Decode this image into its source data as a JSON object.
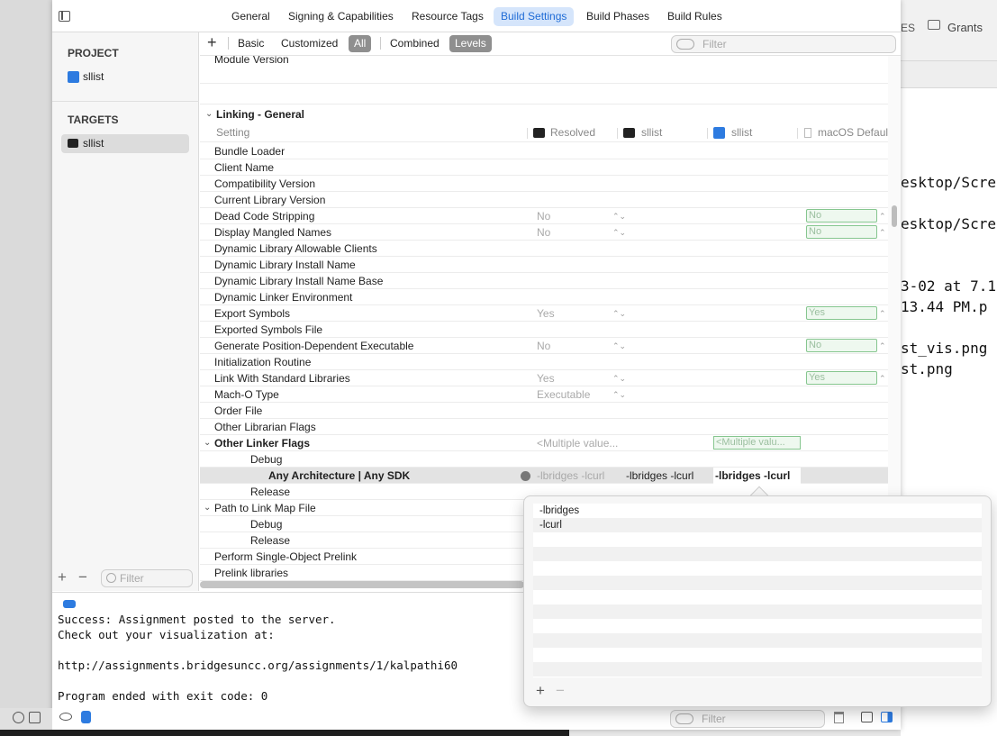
{
  "window_tabs": [
    "General",
    "Signing & Capabilities",
    "Resource Tags",
    "Build Settings",
    "Build Phases",
    "Build Rules"
  ],
  "active_tab": "Build Settings",
  "sidebar": {
    "project_header": "PROJECT",
    "project_item": "sllist",
    "targets_header": "TARGETS",
    "target_item": "sllist",
    "filter_placeholder": "Filter"
  },
  "scope_bar": {
    "add": "+",
    "basic": "Basic",
    "customized": "Customized",
    "all": "All",
    "combined": "Combined",
    "levels": "Levels",
    "filter_placeholder": "Filter"
  },
  "prev_row": "Module Version",
  "section": {
    "title": "Linking - General",
    "col_setting": "Setting",
    "col_resolved": "Resolved",
    "col_target": "sllist",
    "col_project": "sllist",
    "col_default": "macOS Default"
  },
  "rows": [
    {
      "name": "Bundle Loader",
      "resolved": "",
      "target": "",
      "project": "",
      "default": ""
    },
    {
      "name": "Client Name",
      "resolved": "",
      "target": "",
      "project": "",
      "default": ""
    },
    {
      "name": "Compatibility Version",
      "resolved": "",
      "target": "",
      "project": "",
      "default": ""
    },
    {
      "name": "Current Library Version",
      "resolved": "",
      "target": "",
      "project": "",
      "default": ""
    },
    {
      "name": "Dead Code Stripping",
      "resolved": "No",
      "target": "",
      "project": "",
      "default": "No"
    },
    {
      "name": "Display Mangled Names",
      "resolved": "No",
      "target": "",
      "project": "",
      "default": "No"
    },
    {
      "name": "Dynamic Library Allowable Clients",
      "resolved": "",
      "target": "",
      "project": "",
      "default": ""
    },
    {
      "name": "Dynamic Library Install Name",
      "resolved": "",
      "target": "",
      "project": "",
      "default": ""
    },
    {
      "name": "Dynamic Library Install Name Base",
      "resolved": "",
      "target": "",
      "project": "",
      "default": ""
    },
    {
      "name": "Dynamic Linker Environment",
      "resolved": "",
      "target": "",
      "project": "",
      "default": ""
    },
    {
      "name": "Export Symbols",
      "resolved": "Yes",
      "target": "",
      "project": "",
      "default": "Yes"
    },
    {
      "name": "Exported Symbols File",
      "resolved": "",
      "target": "",
      "project": "",
      "default": ""
    },
    {
      "name": "Generate Position-Dependent Executable",
      "resolved": "No",
      "target": "",
      "project": "",
      "default": "No"
    },
    {
      "name": "Initialization Routine",
      "resolved": "",
      "target": "",
      "project": "",
      "default": ""
    },
    {
      "name": "Link With Standard Libraries",
      "resolved": "Yes",
      "target": "",
      "project": "",
      "default": "Yes"
    },
    {
      "name": "Mach-O Type",
      "resolved": "Executable",
      "target": "",
      "project": "",
      "default": ""
    },
    {
      "name": "Order File",
      "resolved": "",
      "target": "",
      "project": "",
      "default": ""
    },
    {
      "name": "Other Librarian Flags",
      "resolved": "",
      "target": "",
      "project": "",
      "default": ""
    }
  ],
  "other_linker": {
    "name": "Other Linker Flags",
    "resolved": "<Multiple value...",
    "project": "<Multiple valu...",
    "debug": "Debug",
    "any_arch": "Any Architecture | Any SDK",
    "any_resolved": "-lbridges -lcurl",
    "any_target": "-lbridges -lcurl",
    "any_project": "-lbridges -lcurl",
    "release": "Release"
  },
  "rows_after": [
    {
      "name": "Path to Link Map File",
      "bold": false,
      "disclosure": true
    },
    {
      "name": "Debug",
      "indent": true
    },
    {
      "name": "Release",
      "indent": true
    },
    {
      "name": "Perform Single-Object Prelink"
    },
    {
      "name": "Prelink libraries"
    }
  ],
  "popover": {
    "items": [
      "-lbridges",
      "-lcurl"
    ],
    "add": "+",
    "remove": "−"
  },
  "console": [
    "Success: Assignment posted to the server.",
    "Check out your visualization at:",
    "",
    "http://assignments.bridgesuncc.org/assignments/1/kalpathi60",
    "",
    "Program ended with exit code: 0"
  ],
  "debug_filter_placeholder": "Filter",
  "right_terminal": [
    "esktop/Scre",
    "esktop/Scre",
    "3-02 at 7.1",
    "13.44 PM.p",
    "st_vis.png",
    "st.png"
  ],
  "right_toolbar": {
    "text1": "ES",
    "text2": "Grants"
  },
  "colors": {
    "accent": "#1e6bd6",
    "green_border": "#86c68f"
  }
}
